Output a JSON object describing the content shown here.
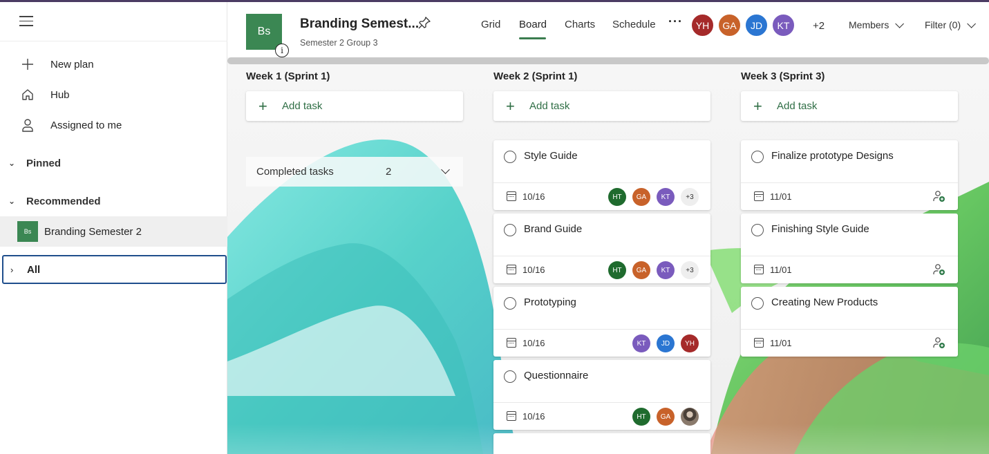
{
  "sidebar": {
    "nav": [
      {
        "label": "New plan",
        "icon": "plus-icon"
      },
      {
        "label": "Hub",
        "icon": "home-icon"
      },
      {
        "label": "Assigned to me",
        "icon": "person-icon"
      }
    ],
    "pinned_label": "Pinned",
    "recommended_label": "Recommended",
    "recommended_item": {
      "abbr": "Bs",
      "label": "Branding Semester 2"
    },
    "all_label": "All"
  },
  "header": {
    "plan_abbr": "Bs",
    "title": "Branding Semest...",
    "subtitle": "Semester 2 Group 3",
    "tabs": [
      "Grid",
      "Board",
      "Charts",
      "Schedule"
    ],
    "active_tab": "Board",
    "more": "···",
    "members": [
      {
        "initials": "YH",
        "color": "#a52a2a"
      },
      {
        "initials": "GA",
        "color": "#c8622a"
      },
      {
        "initials": "JD",
        "color": "#2b76d2"
      },
      {
        "initials": "KT",
        "color": "#7a5bbd"
      }
    ],
    "extra_members": "+2",
    "members_label": "Members",
    "filter_label": "Filter (0)"
  },
  "board": {
    "add_task_label": "Add task",
    "columns": [
      {
        "title": "Week 1 (Sprint 1)"
      },
      {
        "title": "Week 2 (Sprint 1)"
      },
      {
        "title": "Week 3 (Sprint 3)"
      }
    ],
    "completed": {
      "label": "Completed tasks",
      "count": "2"
    },
    "week2_cards": [
      {
        "title": "Style Guide",
        "date": "10/16"
      },
      {
        "title": "Brand Guide",
        "date": "10/16"
      },
      {
        "title": "Prototyping",
        "date": "10/16"
      },
      {
        "title": "Questionnaire",
        "date": "10/16"
      }
    ],
    "week3_cards": [
      {
        "title": "Finalize prototype Designs",
        "date": "11/01"
      },
      {
        "title": "Finishing Style Guide",
        "date": "11/01"
      },
      {
        "title": "Creating New Products",
        "date": "11/01"
      }
    ],
    "assignees": {
      "HT": {
        "initials": "HT",
        "color": "#1f6b2e"
      },
      "GA": {
        "initials": "GA",
        "color": "#c8622a"
      },
      "KT": {
        "initials": "KT",
        "color": "#7a5bbd"
      },
      "JD": {
        "initials": "JD",
        "color": "#2b76d2"
      },
      "YH": {
        "initials": "YH",
        "color": "#a52a2a"
      },
      "more": "+3"
    }
  }
}
